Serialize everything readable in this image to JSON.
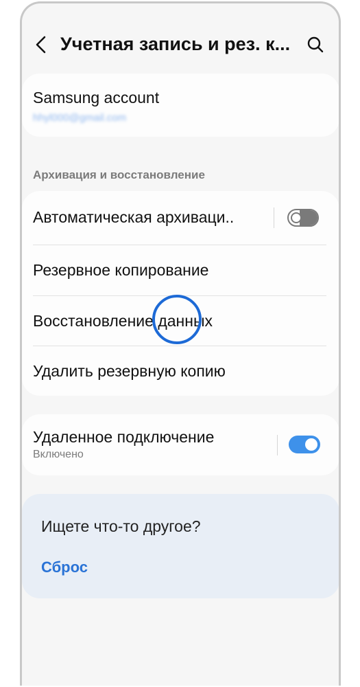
{
  "header": {
    "title": "Учетная запись и рез. к...",
    "back_icon": "chevron-left-icon",
    "search_icon": "search-icon"
  },
  "account": {
    "title": "Samsung account",
    "email": "hhyl000@gmail.com"
  },
  "backup_section": {
    "header": "Архивация и восстановление",
    "items": [
      {
        "label": "Автоматическая архиваци..",
        "toggle": "off"
      },
      {
        "label": "Резервное копирование"
      },
      {
        "label": "Восстановление данных"
      },
      {
        "label": "Удалить резервную копию"
      }
    ]
  },
  "remote": {
    "title": "Удаленное подключение",
    "status": "Включено",
    "toggle": "on"
  },
  "suggest": {
    "title": "Ищете что-то другое?",
    "link": "Сброс"
  },
  "colors": {
    "accent": "#3e91ea",
    "link": "#2a73d6",
    "tap_highlight": "#1d6ad6",
    "background": "#f6f6f6"
  }
}
